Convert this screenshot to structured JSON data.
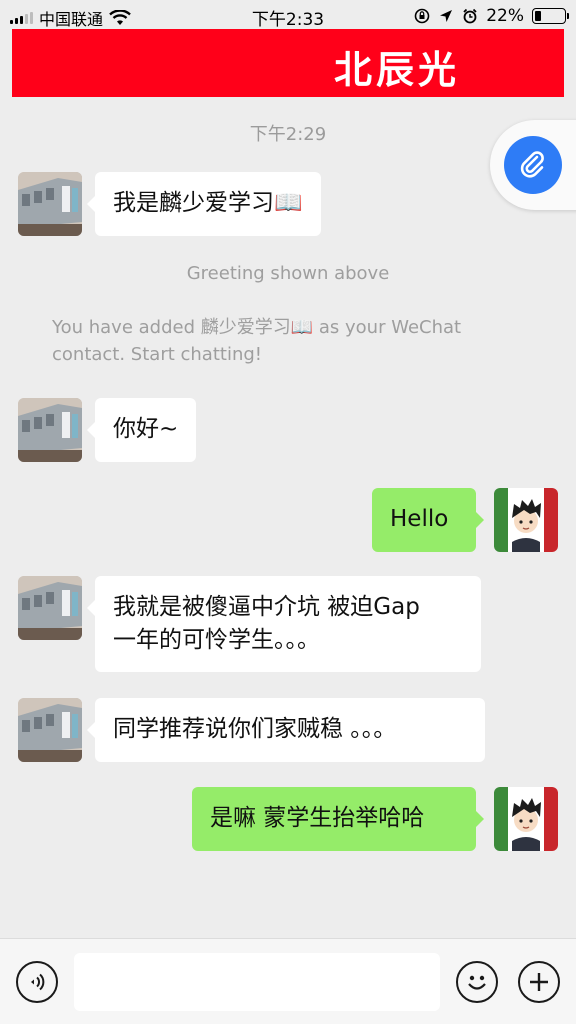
{
  "status_bar": {
    "carrier": "中国联通",
    "time": "下午2:33",
    "battery": "22%"
  },
  "banner": {
    "title": "北辰光",
    "color": "#ff0019"
  },
  "chat": {
    "timestamp": "下午2:29",
    "greeting_note": "Greeting shown above",
    "added_note_line1": "You have added 麟少爱学习📖 as your WeChat",
    "added_note_line2": "contact. Start chatting!",
    "messages": [
      {
        "from": "contact",
        "text": "我是麟少爱学习📖"
      },
      {
        "from": "contact",
        "text": "你好~"
      },
      {
        "from": "me",
        "text": "Hello"
      },
      {
        "from": "contact",
        "line1": "我就是被傻逼中介坑 被迫Gap",
        "line2": "一年的可怜学生。。。"
      },
      {
        "from": "contact",
        "text": "同学推荐说你们家贼稳 。。。"
      },
      {
        "from": "me",
        "text": "是嘛 蒙学生抬举哈哈"
      }
    ]
  },
  "input_bar": {
    "value": "",
    "voice_icon": "voice-icon",
    "emoji_icon": "emoji-icon",
    "plus_icon": "plus-icon"
  },
  "colors": {
    "background": "#ededed",
    "outgoing_bubble": "#95ec69",
    "incoming_bubble": "#ffffff",
    "attach_button": "#2e7cf6"
  }
}
